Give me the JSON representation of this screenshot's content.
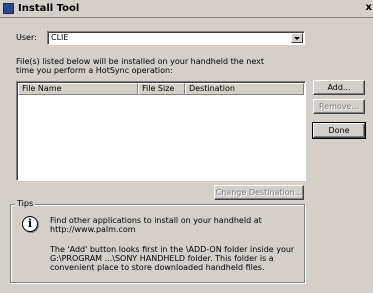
{
  "window": {
    "title": "Install Tool",
    "close_glyph": "x",
    "icon": "palm-app-icon"
  },
  "user": {
    "label": "User:",
    "value": "CLIE"
  },
  "description": {
    "line1": "File(s) listed below will be installed on your handheld the next",
    "line2": "time you perform a HotSync operation:"
  },
  "list": {
    "columns": [
      "File Name",
      "File Size",
      "Destination"
    ],
    "rows": []
  },
  "buttons": {
    "add": "Add...",
    "remove": "Remove...",
    "done": "Done",
    "change_destination": "Change Destination..."
  },
  "tips": {
    "label": "Tips",
    "icon": "info-icon",
    "p1_line1": "Find other applications to install on your handheld at",
    "p1_line2": "http://www.palm.com",
    "p2_line1": "The 'Add' button looks first in the \\ADD-ON folder inside your",
    "p2_line2": "G:\\PROGRAM ...\\SONY HANDHELD folder. This folder is a",
    "p2_line3": "convenient place to store downloaded handheld files."
  }
}
